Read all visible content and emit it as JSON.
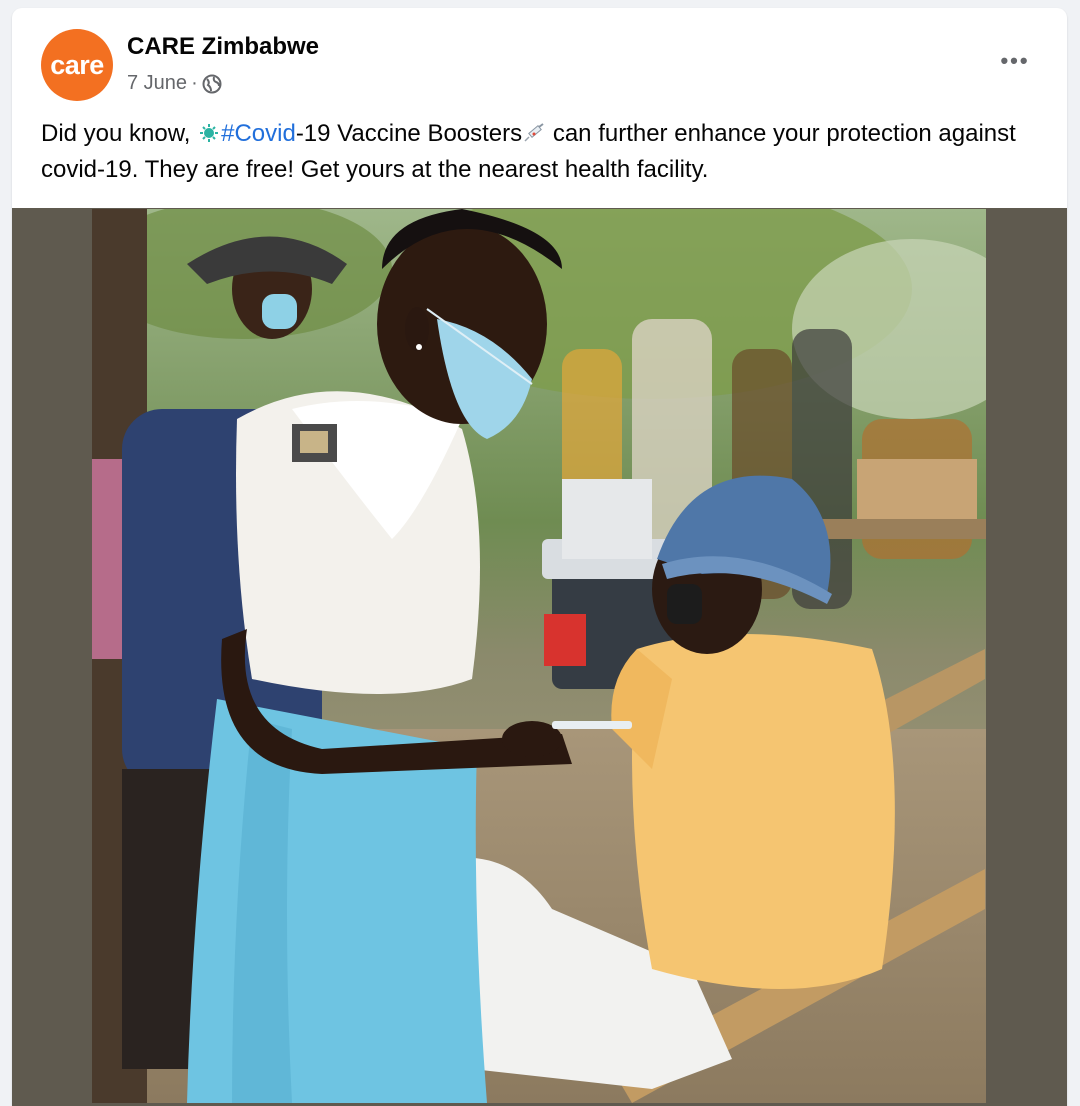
{
  "post": {
    "page_name": "CARE Zimbabwe",
    "avatar_label": "care",
    "date": "7 June",
    "separator": "·",
    "audience_icon": "globe-icon",
    "more_options": "•••",
    "text": {
      "part1": "Did you know, ",
      "hashtag": "#Covid",
      "part2": "-19 Vaccine Boosters",
      "part3": " can further enhance your protection against covid-19. They are free! Get yours at the nearest health facility."
    },
    "icons": {
      "virus": "virus-icon",
      "syringe": "syringe-icon"
    }
  },
  "colors": {
    "brand": "#f37021",
    "hashtag": "#216fdb",
    "background": "#f0f2f5",
    "photo_frame": "#5f5a4f"
  }
}
